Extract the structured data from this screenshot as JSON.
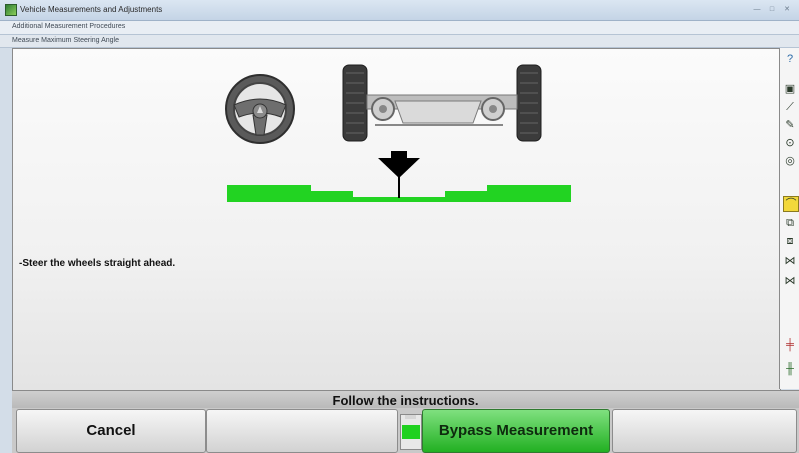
{
  "window": {
    "title": "Vehicle Measurements and Adjustments",
    "controls": [
      "—",
      "□",
      "✕"
    ]
  },
  "breadcrumbs": [
    "Additional Measurement Procedures",
    "Measure Maximum Steering Angle"
  ],
  "main": {
    "instruction": "-Steer the wheels straight ahead."
  },
  "status": {
    "text": "Follow the instructions."
  },
  "buttons": {
    "cancel": "Cancel",
    "bypass": "Bypass Measurement"
  },
  "colors": {
    "indicator_green": "#22d322",
    "bypass_green": "#22b022",
    "pointer": "#000000"
  },
  "toolbar": {
    "icons": [
      "help-icon",
      "vehicle-icon",
      "camber-icon",
      "wrench-icon",
      "caster-icon",
      "steering-angle-icon",
      "axle-icon",
      "wheels-icon",
      "tire-icon",
      "toe-icon",
      "measure-icon",
      "rear-axle-icon",
      "chassis-icon"
    ],
    "active": "steering-angle-icon"
  }
}
